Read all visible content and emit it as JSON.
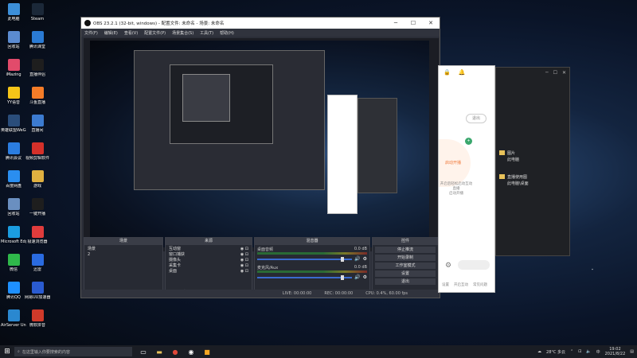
{
  "desktop_icons": [
    {
      "label": "此电脑",
      "icon": "computer-icon",
      "color": "#3c8fd8"
    },
    {
      "label": "Steam",
      "icon": "steam-icon",
      "color": "#1b2838"
    },
    {
      "label": "回收站",
      "icon": "recycle-bin-icon",
      "color": "#5b8bd0"
    },
    {
      "label": "腾讯课堂",
      "icon": "tencent-class-icon",
      "color": "#2a7ad3"
    },
    {
      "label": "iMazing",
      "icon": "imazing-icon",
      "color": "#e24b6b"
    },
    {
      "label": "直播伴侣",
      "icon": "live-companion-icon",
      "color": "#1e1e1e"
    },
    {
      "label": "YY语音",
      "icon": "yy-icon",
      "color": "#f5c518"
    },
    {
      "label": "斗鱼直播",
      "icon": "douyu-icon",
      "color": "#f57c28"
    },
    {
      "label": "英雄联盟WeGame",
      "icon": "wegame-icon",
      "color": "#2a4d7a"
    },
    {
      "label": "直播间",
      "icon": "live-room-icon",
      "color": "#3c7bd0"
    },
    {
      "label": "腾讯会议",
      "icon": "tencent-meeting-icon",
      "color": "#2b7de0"
    },
    {
      "label": "视频剪辑软件",
      "icon": "video-editor-icon",
      "color": "#d4302a"
    },
    {
      "label": "百度网盘",
      "icon": "baidu-netdisk-icon",
      "color": "#2a8ef0"
    },
    {
      "label": "游戏",
      "icon": "game-folder-icon",
      "color": "#e0b040"
    },
    {
      "label": "回收站",
      "icon": "trash-icon",
      "color": "#6a8fc0"
    },
    {
      "label": "一键开播",
      "icon": "start-live-icon",
      "color": "#1e1e1e"
    },
    {
      "label": "Microsoft Edge",
      "icon": "edge-icon",
      "color": "#1b9de0"
    },
    {
      "label": "极速浏览器",
      "icon": "browser-icon",
      "color": "#e03c3c"
    },
    {
      "label": "微信",
      "icon": "wechat-icon",
      "color": "#2fb84a"
    },
    {
      "label": "迅雷",
      "icon": "xunlei-icon",
      "color": "#2a6be0"
    },
    {
      "label": "腾讯QQ",
      "icon": "qq-icon",
      "color": "#1e90ff"
    },
    {
      "label": "网易UU加速器",
      "icon": "uu-icon",
      "color": "#2a5bd0"
    },
    {
      "label": "AirServer Univers...",
      "icon": "airserver-icon",
      "color": "#2a88d0"
    },
    {
      "label": "微软拼音",
      "icon": "ime-icon",
      "color": "#d03a2a"
    }
  ],
  "obs": {
    "title": "OBS 23.2.1 (32-bit, windows) - 配置文件: 未命名 - 场景: 未命名",
    "menu": [
      "文件(F)",
      "编辑(E)",
      "查看(V)",
      "配置文件(P)",
      "场景集合(S)",
      "工具(T)",
      "帮助(H)"
    ],
    "scenes": {
      "title": "场景",
      "items": [
        "场景",
        "2"
      ]
    },
    "sources": {
      "title": "来源",
      "items": [
        "互动窗",
        "窗口捕获",
        "摄像头",
        "采集卡",
        "桌面"
      ]
    },
    "mixer": {
      "title": "混音器",
      "channels": [
        {
          "name": "桌面音频",
          "db": "0.0 dB"
        },
        {
          "name": "麦克风/Aux",
          "db": "0.0 dB"
        }
      ]
    },
    "controls": {
      "title": "控件",
      "buttons": [
        "停止推流",
        "开始录制",
        "工作室模式",
        "设置",
        "退出"
      ],
      "tabs": [
        "控件",
        "场景转换"
      ]
    },
    "status": {
      "live": "LIVE: 00:00:00",
      "rec": "REC: 00:00:00",
      "cpu": "CPU: 0.4%, 60.00 fps"
    }
  },
  "phone_app": {
    "logout": "退出",
    "tab1": "启动开播",
    "hint": "开启后轻松启动互动直播",
    "hint2": "启动开播",
    "bottom": [
      "设置",
      "开启互动",
      "常见问题"
    ]
  },
  "explorer": {
    "items": [
      "图片",
      "此电脑",
      "直播使用图",
      "此电脑\\桌面"
    ]
  },
  "taskbar": {
    "search_placeholder": "在这里输入你要搜索的内容",
    "weather": "28°C 多云",
    "time": "19:02",
    "date": "2021/8/22",
    "lang": "中"
  }
}
